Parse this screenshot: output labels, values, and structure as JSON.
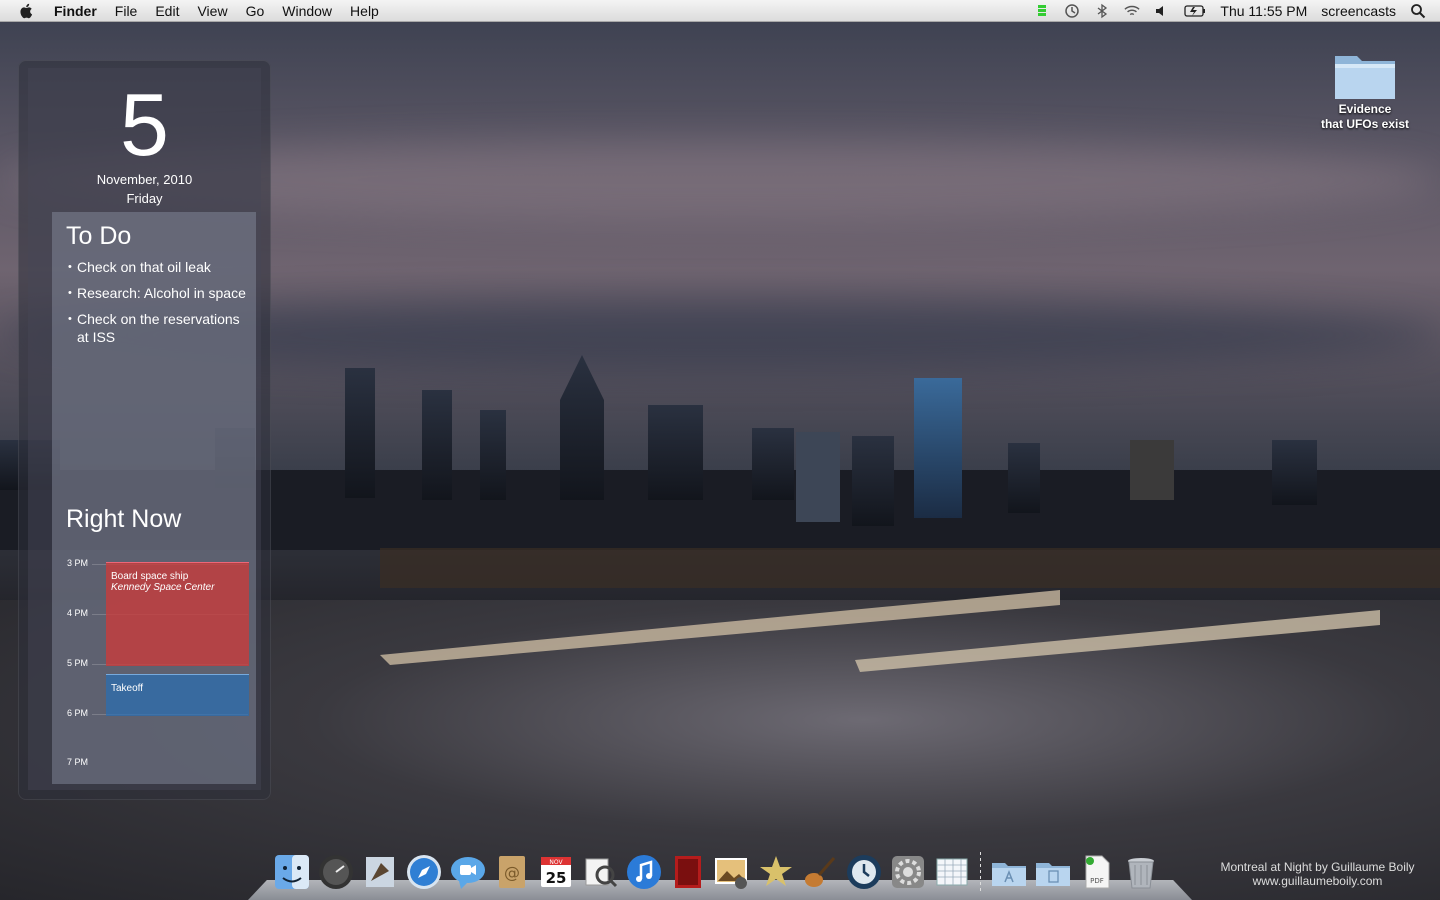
{
  "menubar": {
    "app_name": "Finder",
    "menus": [
      "File",
      "Edit",
      "View",
      "Go",
      "Window",
      "Help"
    ],
    "clock": "Thu 11:55 PM",
    "user": "screencasts",
    "status_icons": [
      "battery-meter-icon",
      "time-machine-icon",
      "bluetooth-icon",
      "wifi-icon",
      "volume-icon",
      "battery-icon",
      "spotlight-icon"
    ]
  },
  "desktop": {
    "folder_label_line1": "Evidence",
    "folder_label_line2": "that UFOs exist"
  },
  "widget": {
    "date_number": "5",
    "month_year": "November, 2010",
    "weekday": "Friday",
    "todo": {
      "title": "To Do",
      "items": [
        "Check on that oil leak",
        "Research: Alcohol in space",
        "Check on the reservations at ISS"
      ]
    },
    "right_now": {
      "title": "Right Now",
      "hours": [
        "3 PM",
        "4 PM",
        "5 PM",
        "6 PM",
        "7 PM"
      ],
      "events": [
        {
          "title": "Board space ship",
          "location": "Kennedy Space Center",
          "color": "#c83c3c"
        },
        {
          "title": "Takeoff",
          "location": "",
          "color": "#286eb4"
        }
      ]
    }
  },
  "dock": {
    "items": [
      "finder-icon",
      "dashboard-icon",
      "mail-icon",
      "safari-icon",
      "ichat-icon",
      "address-book-icon",
      "ical-icon",
      "preview-icon",
      "itunes-icon",
      "photo-booth-icon",
      "iphoto-icon",
      "imovie-icon",
      "garageband-icon",
      "time-machine-icon",
      "system-preferences-icon",
      "calendar-app-icon",
      "applications-folder-icon",
      "documents-folder-icon",
      "pdf-file-icon",
      "trash-icon"
    ],
    "ical_date": "25",
    "ical_month": "NOV"
  },
  "credit": {
    "line1": "Montreal at Night by Guillaume Boily",
    "line2": "www.guillaumeboily.com"
  },
  "colors": {
    "widget_panel": "#2d303a",
    "event_red": "#c83c3c",
    "event_blue": "#286eb4"
  }
}
